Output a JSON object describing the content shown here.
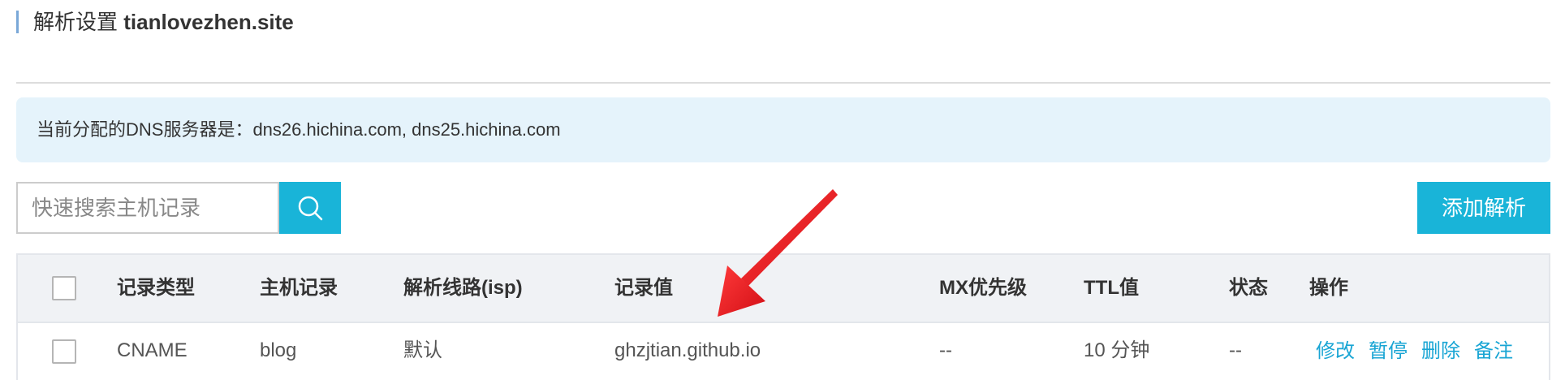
{
  "header": {
    "title_prefix": "解析设置",
    "domain": "tianlovezhen.site"
  },
  "dns_banner": {
    "text": "当前分配的DNS服务器是：dns26.hichina.com, dns25.hichina.com"
  },
  "search": {
    "placeholder": "快速搜索主机记录",
    "value": "",
    "button_icon": "search-icon"
  },
  "toolbar": {
    "add_label": "添加解析"
  },
  "table": {
    "columns": [
      "记录类型",
      "主机记录",
      "解析线路(isp)",
      "记录值",
      "MX优先级",
      "TTL值",
      "状态",
      "操作"
    ],
    "rows": [
      {
        "type": "CNAME",
        "host": "blog",
        "line": "默认",
        "value": "ghzjtian.github.io",
        "mx": "--",
        "ttl": "10 分钟",
        "status": "--",
        "actions": [
          "修改",
          "暂停",
          "删除",
          "备注"
        ]
      }
    ]
  },
  "annotation": {
    "arrow_color": "#e8141c"
  },
  "colors": {
    "accent": "#19b4d8",
    "link": "#19a5d4",
    "banner_bg": "#e5f3fb",
    "title_bar": "#7aa8d8"
  }
}
